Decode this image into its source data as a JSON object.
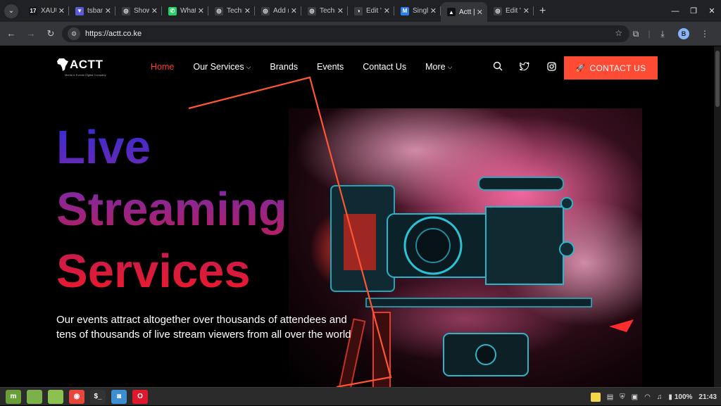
{
  "browser": {
    "tabs": [
      {
        "title": "XAUUS",
        "icon": "tradingview-icon",
        "color": "#131722",
        "glyph": "17",
        "active": false
      },
      {
        "title": "tsban",
        "icon": "bookmark-icon",
        "color": "#5b5bd6",
        "glyph": "▼",
        "active": false
      },
      {
        "title": "Show",
        "icon": "globe-icon",
        "color": "#3c3d40",
        "glyph": "◎",
        "active": false
      },
      {
        "title": "What",
        "icon": "whatsapp-icon",
        "color": "#25d366",
        "glyph": "✆",
        "active": false
      },
      {
        "title": "Techr",
        "icon": "globe-icon",
        "color": "#3c3d40",
        "glyph": "◎",
        "active": false
      },
      {
        "title": "Add n",
        "icon": "globe-icon",
        "color": "#3c3d40",
        "glyph": "◎",
        "active": false
      },
      {
        "title": "Techr",
        "icon": "globe-icon",
        "color": "#3c3d40",
        "glyph": "◎",
        "active": false
      },
      {
        "title": "Edit \"",
        "icon": "wordpress-icon",
        "color": "#3c3d40",
        "glyph": "◑",
        "active": false
      },
      {
        "title": "Single",
        "icon": "m-logo-icon",
        "color": "#2b7de9",
        "glyph": "M",
        "active": false
      },
      {
        "title": "Actt |",
        "icon": "actt-favicon",
        "color": "#111111",
        "glyph": "▲",
        "active": true
      },
      {
        "title": "Edit \"",
        "icon": "globe-icon",
        "color": "#3c3d40",
        "glyph": "◎",
        "active": false
      }
    ],
    "url": "https://actt.co.ke",
    "profile_initial": "B"
  },
  "site": {
    "logo_text": "ACTT",
    "logo_tagline": "Media & Events Digital Company",
    "nav": {
      "home": "Home",
      "services": "Our Services",
      "brands": "Brands",
      "events": "Events",
      "contact": "Contact Us",
      "more": "More"
    },
    "cta": "CONTACT US",
    "hero": {
      "line1": "Live",
      "line2": "Streaming",
      "line3": "Services",
      "body": "Our events attract altogether over thousands of attendees and tens of thousands of live stream viewers from all over the world"
    },
    "colors": {
      "accent": "#ff4b33",
      "nav_active": "#ff3b2f",
      "gradient_top": "#2d2bd8",
      "gradient_bottom": "#ff1818",
      "annotation": "#ff5533"
    }
  },
  "taskbar": {
    "apps": [
      {
        "icon": "mint-menu-icon",
        "color": "#6a9e3a",
        "glyph": "m"
      },
      {
        "icon": "folder-icon",
        "color": "#7bb04a",
        "glyph": ""
      },
      {
        "icon": "folder-icon",
        "color": "#8cc152",
        "glyph": ""
      },
      {
        "icon": "chrome-icon",
        "color": "#e8453c",
        "glyph": "◉"
      },
      {
        "icon": "terminal-icon",
        "color": "#333333",
        "glyph": "$_"
      },
      {
        "icon": "screenshot-icon",
        "color": "#3d8fd1",
        "glyph": "◙"
      },
      {
        "icon": "opera-icon",
        "color": "#e0182d",
        "glyph": "O"
      }
    ],
    "battery": "100%",
    "clock": "21:43"
  }
}
